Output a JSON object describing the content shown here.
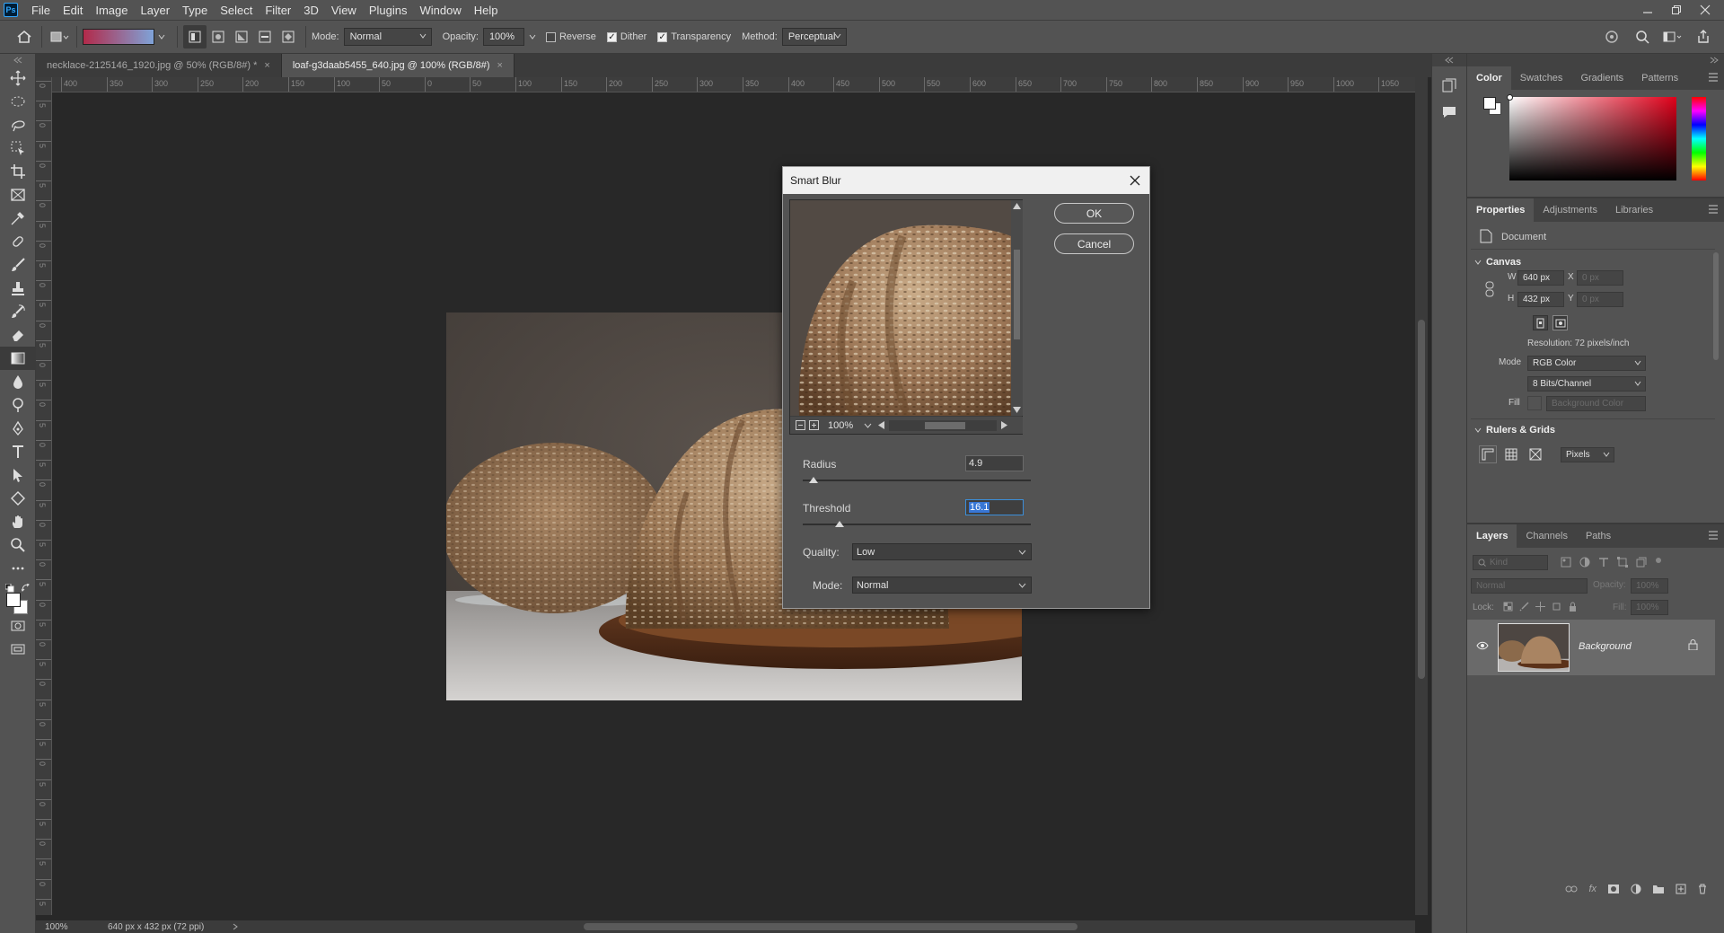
{
  "app": {
    "logo_text": "Ps"
  },
  "menu": [
    "File",
    "Edit",
    "Image",
    "Layer",
    "Type",
    "Select",
    "Filter",
    "3D",
    "View",
    "Plugins",
    "Window",
    "Help"
  ],
  "options_bar": {
    "mode_label": "Mode:",
    "mode_value": "Normal",
    "opacity_label": "Opacity:",
    "opacity_value": "100%",
    "reverse_label": "Reverse",
    "dither_label": "Dither",
    "transparency_label": "Transparency",
    "method_label": "Method:",
    "method_value": "Perceptual",
    "gradient_colors": [
      "#b22a4a",
      "#7fa3d8"
    ]
  },
  "tabs": [
    {
      "label": "necklace-2125146_1920.jpg @ 50% (RGB/8#) *",
      "close": "×"
    },
    {
      "label": "loaf-g3daab5455_640.jpg @ 100% (RGB/8#)",
      "close": "×"
    }
  ],
  "ruler": {
    "h_labels": [
      "400",
      "350",
      "300",
      "250",
      "200",
      "150",
      "100",
      "50",
      "0",
      "50",
      "100",
      "150",
      "200",
      "250",
      "300",
      "350",
      "400",
      "450",
      "500",
      "550",
      "600",
      "650",
      "700",
      "750",
      "800",
      "850",
      "900",
      "950",
      "1000",
      "1050"
    ],
    "v_labels": [
      "0",
      "5",
      "0",
      "5",
      "0",
      "5",
      "0",
      "5",
      "0",
      "5",
      "0",
      "5",
      "0",
      "5",
      "0",
      "5",
      "0",
      "5",
      "0",
      "5",
      "0",
      "5",
      "0",
      "5",
      "0",
      "5",
      "0",
      "5",
      "0",
      "5",
      "0",
      "5",
      "0",
      "5",
      "0",
      "5",
      "0",
      "5",
      "0",
      "5",
      "0",
      "5"
    ]
  },
  "status": {
    "zoom": "100%",
    "doc_info": "640 px x 432 px (72 ppi)"
  },
  "dialog": {
    "title": "Smart Blur",
    "ok": "OK",
    "cancel": "Cancel",
    "preview_zoom": "100%",
    "radius_label": "Radius",
    "radius_value": "4.9",
    "radius_fraction": 0.049,
    "threshold_label": "Threshold",
    "threshold_value": "16.1",
    "threshold_fraction": 0.161,
    "quality_label": "Quality:",
    "quality_value": "Low",
    "mode_label": "Mode:",
    "mode_value": "Normal"
  },
  "color_panel": {
    "tabs": [
      "Color",
      "Swatches",
      "Gradients",
      "Patterns"
    ],
    "hue": "#e0001a"
  },
  "properties_panel": {
    "tabs": [
      "Properties",
      "Adjustments",
      "Libraries"
    ],
    "document_label": "Document",
    "canvas_header": "Canvas",
    "w_label": "W",
    "w_value": "640 px",
    "h_label": "H",
    "h_value": "432 px",
    "x_label": "X",
    "x_placeholder": "0 px",
    "y_label": "Y",
    "y_placeholder": "0 px",
    "resolution": "Resolution: 72 pixels/inch",
    "mode_label": "Mode",
    "mode_value": "RGB Color",
    "bits_value": "8 Bits/Channel",
    "fill_label": "Fill",
    "fill_value": "Background Color",
    "rulers_header": "Rulers & Grids",
    "units_value": "Pixels"
  },
  "layers_panel": {
    "tabs": [
      "Layers",
      "Channels",
      "Paths"
    ],
    "kind_placeholder": "Kind",
    "blend_mode": "Normal",
    "opacity_label": "Opacity:",
    "opacity_value": "100%",
    "lock_label": "Lock:",
    "fill_label": "Fill:",
    "fill_value": "100%",
    "layer_name": "Background"
  }
}
